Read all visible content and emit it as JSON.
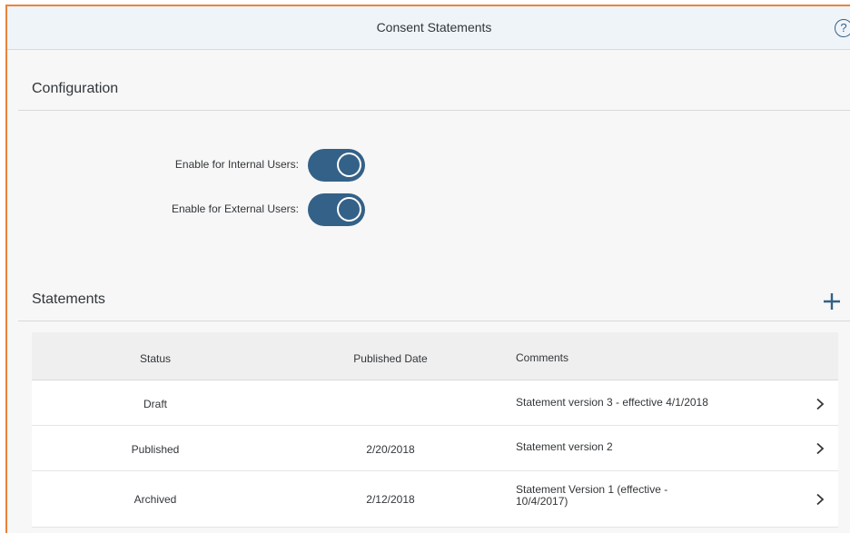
{
  "header": {
    "title": "Consent Statements",
    "help_glyph": "?"
  },
  "configuration": {
    "title": "Configuration",
    "toggles": [
      {
        "label": "Enable for Internal Users:",
        "on": true
      },
      {
        "label": "Enable for External Users:",
        "on": true
      }
    ]
  },
  "statements": {
    "title": "Statements",
    "columns": {
      "status": "Status",
      "published_date": "Published Date",
      "comments": "Comments"
    },
    "rows": [
      {
        "status": "Draft",
        "published_date": "",
        "comments": "Statement version 3 - effective 4/1/2018"
      },
      {
        "status": "Published",
        "published_date": "2/20/2018",
        "comments": "Statement version 2"
      },
      {
        "status": "Archived",
        "published_date": "2/12/2018",
        "comments": "Statement Version 1 (effective - 10/4/2017)"
      }
    ]
  },
  "colors": {
    "accent": "#346187",
    "frame_border": "#e8843c",
    "header_bg": "#eff4f9"
  },
  "icons": {
    "help": "help-icon",
    "add": "plus-icon",
    "row_nav": "chevron-right-icon"
  }
}
